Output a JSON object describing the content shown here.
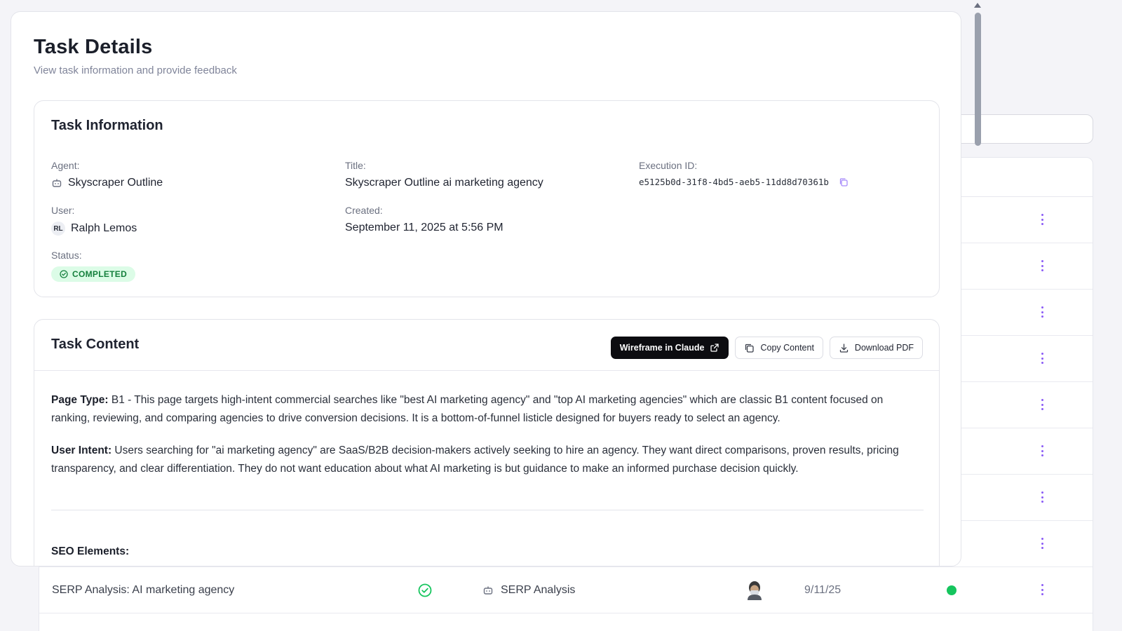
{
  "page": {
    "title": "Task Details",
    "subtitle": "View task information and provide feedback"
  },
  "task_info": {
    "heading": "Task Information",
    "agent_label": "Agent:",
    "agent_value": "Skyscraper Outline",
    "title_label": "Title:",
    "title_value": "Skyscraper Outline ai marketing agency",
    "execution_label": "Execution ID:",
    "execution_value": "e5125b0d-31f8-4bd5-aeb5-11dd8d70361b",
    "user_label": "User:",
    "user_initials": "RL",
    "user_value": "Ralph Lemos",
    "created_label": "Created:",
    "created_value": "September 11, 2025 at 5:56 PM",
    "status_label": "Status:",
    "status_value": "COMPLETED",
    "status_color": "#15803d"
  },
  "task_content": {
    "heading": "Task Content",
    "buttons": {
      "wireframe": "Wireframe in Claude",
      "copy": "Copy Content",
      "download": "Download PDF"
    },
    "page_type_label": "Page Type:",
    "page_type_text": " B1 - This page targets high-intent commercial searches like \"best AI marketing agency\" and \"top AI marketing agencies\" which are classic B1 content focused on ranking, reviewing, and comparing agencies to drive conversion decisions. It is a bottom-of-funnel listicle designed for buyers ready to select an agency.",
    "user_intent_label": "User Intent:",
    "user_intent_text": " Users searching for \"ai marketing agency\" are SaaS/B2B decision-makers actively seeking to hire an agency. They want direct comparisons, proven results, pricing transparency, and clear differentiation. They do not want education about what AI marketing is but guidance to make an informed purchase decision quickly.",
    "seo_label": "SEO Elements:"
  },
  "background_rows": [
    {
      "title": "SERP Analysis: AI marketing agency",
      "agent": "SERP Analysis",
      "date": "9/11/25",
      "status_color": "#16c55e"
    }
  ],
  "colors": {
    "accent": "#8b5cf6",
    "success": "#16c55e",
    "danger": "#ef4444"
  }
}
